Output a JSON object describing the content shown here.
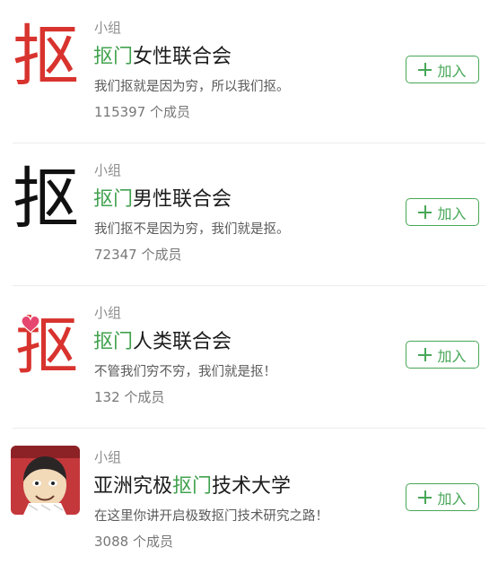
{
  "groups": [
    {
      "avatar_icon": "kou-character-red-icon",
      "avatar_char": "抠",
      "avatar_color": "#d8332e",
      "type_label": "小组",
      "name_highlight": "抠门",
      "name_rest": "女性联合会",
      "description": "我们抠就是因为穷，所以我们抠。",
      "member_count": "115397 个成员",
      "join_label": "加入"
    },
    {
      "avatar_icon": "kou-character-black-icon",
      "avatar_char": "抠",
      "avatar_color": "#111111",
      "type_label": "小组",
      "name_highlight": "抠门",
      "name_rest": "男性联合会",
      "description": "我们抠不是因为穷，我们就是抠。",
      "member_count": "72347 个成员",
      "join_label": "加入"
    },
    {
      "avatar_icon": "kou-character-heart-icon",
      "avatar_char": "抠",
      "avatar_color": "#d8332e",
      "type_label": "小组",
      "name_highlight": "抠门",
      "name_rest": "人类联合会",
      "description": "不管我们穷不穷，我们就是抠！",
      "member_count": "132 个成员",
      "join_label": "加入"
    },
    {
      "avatar_icon": "cartoon-meme-avatar-icon",
      "type_label": "小组",
      "name_prefix": "亚洲究极",
      "name_highlight": "抠门",
      "name_rest": "技术大学",
      "description": "在这里你讲开启极致抠门技术研究之路！",
      "member_count": "3088 个成员",
      "join_label": "加入"
    }
  ],
  "colors": {
    "accent_green": "#47a757",
    "highlight_green": "#42a24f"
  }
}
